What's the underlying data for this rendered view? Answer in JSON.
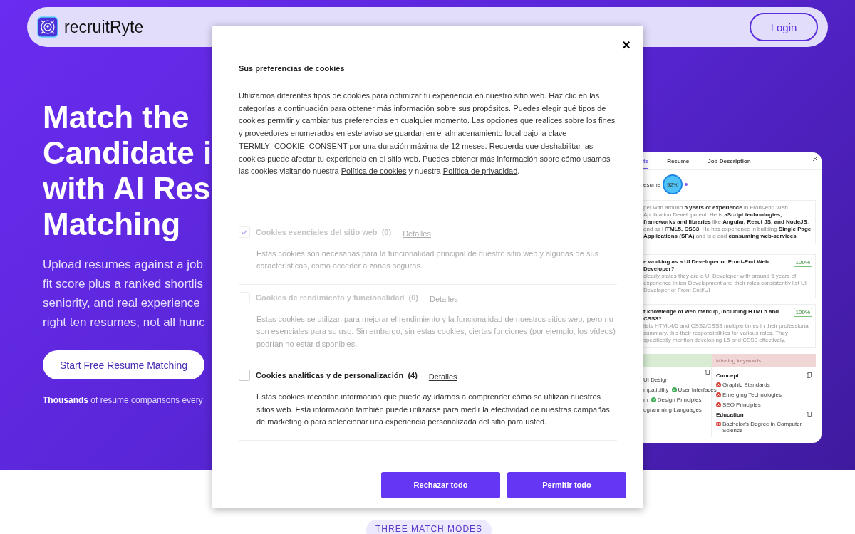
{
  "navbar": {
    "brand": "recruitRyte",
    "login": "Login"
  },
  "hero": {
    "headline": [
      "Match the",
      "Candidate i",
      "with AI Res",
      "Matching"
    ],
    "lines": [
      "Upload resumes against a job",
      "fit score plus a ranked shortlis",
      "seniority, and real experience",
      "right ten resumes, not all hunc"
    ],
    "cta": "Start Free Resume Matching",
    "note": "**Thousands** of resume comparisons every"
  },
  "preview": {
    "tabs": [
      {
        "label": "ts",
        "selected": true
      },
      {
        "label": "Resume",
        "selected": false
      },
      {
        "label": "Job Description",
        "selected": false
      }
    ],
    "score_label": "esume",
    "score": "92%",
    "summary": [
      "per with around **5 years of experience** in Front-end Web Application Development. He is",
      "**aScript technologies, frameworks and libraries** like **Angular, React JS, and NodeJS**, and",
      "as **HTML5, CSS3**. He has experience in building **Single Page Applications (SPA)** and is",
      "g and **consuming web-services**."
    ],
    "questions": [
      {
        "title": "e working as a UI Developer or Front-End Web Developer?",
        "badge": "100%",
        "lines": [
          "clearly states they are a UI Developer with around 5 years of experience in",
          "ion Development and their roles consistently list UI Developer or Front End/UI"
        ]
      },
      {
        "title": "t knowledge of web markup, including HTML5 and CSS3?",
        "badge": "100%",
        "lines": [
          "lists HTML4/5 and CSS2/CSS3 multiple times in their professional summary,",
          "this their responsibilities for various roles. They specifically mention developing",
          "L5 and CSS3 effectively."
        ]
      }
    ],
    "matched_rows": [
      [
        {
          "label": "UI Design",
          "icon": false
        }
      ],
      [
        {
          "label": "mpatibility",
          "icon": false
        },
        {
          "label": "User Interfaces",
          "icon": true
        }
      ],
      [
        {
          "label": "m",
          "icon": false
        },
        {
          "label": "Design Principles",
          "icon": true
        }
      ],
      [
        {
          "label": "ogramming Languages",
          "icon": false
        }
      ]
    ],
    "missing_header": "Missing keywords",
    "missing_groups": [
      {
        "title": "Concept",
        "items": [
          "Graphic Standards",
          "Emerging Technologies",
          "SEO Principles"
        ]
      },
      {
        "title": "Education",
        "items": [
          "Bachelor's Degree in Computer Science"
        ]
      }
    ]
  },
  "cookie_dialog": {
    "close": "×",
    "title": "Sus preferencias de cookies",
    "intro": "Utilizamos diferentes tipos de cookies para optimizar tu experiencia en nuestro sitio web. Haz clic en las categorías a continuación para obtener más información sobre sus propósitos. Puedes elegir qué tipos de cookies permitir y cambiar tus preferencias en cualquier momento. Las opciones que realices sobre los fines y proveedores enumerados en este aviso se guardan en el almacenamiento local bajo la clave TERMLY_COOKIE_CONSENT por una duración máxima de 12 meses. Recuerda que deshabilitar las cookies puede afectar tu experiencia en el sitio web. Puedes obtener más información sobre cómo usamos las cookies visitando nuestra",
    "link1": "Política de cookies",
    "joiner": "y nuestra",
    "link2": "Política de privacidad",
    "end": ".",
    "categories": [
      {
        "name": "Cookies esenciales del sitio web",
        "count": "(0)",
        "details": "Detalles",
        "checked": true,
        "disabled": true,
        "description": "Estas cookies son necesarias para la funcionalidad principal de nuestro sitio web y algunas de sus características, como acceder a zonas seguras."
      },
      {
        "name": "Cookies de rendimiento y funcionalidad",
        "count": "(0)",
        "details": "Detalles",
        "checked": false,
        "disabled": true,
        "description": "Estas cookies se utilizan para mejorar el rendimiento y la funcionalidad de nuestros sitios web, pero no son esenciales para su uso. Sin embargo, sin estas cookies, ciertas funciones (por ejemplo, los vídeos) podrían no estar disponibles."
      },
      {
        "name": "Cookies analíticas y de personalización",
        "count": "(4)",
        "details": "Detalles",
        "checked": false,
        "disabled": false,
        "description": "Estas cookies recopilan información que puede ayudarnos a comprender cómo se utilizan nuestros sitios web. Esta información también puede utilizarse para medir la efectividad de nuestras campañas de marketing o para seleccionar una experiencia personalizada del sitio para usted."
      }
    ],
    "buttons": [
      "Rechazar todo",
      "Permitir todo"
    ]
  },
  "section_badge": "THREE MATCH MODES"
}
